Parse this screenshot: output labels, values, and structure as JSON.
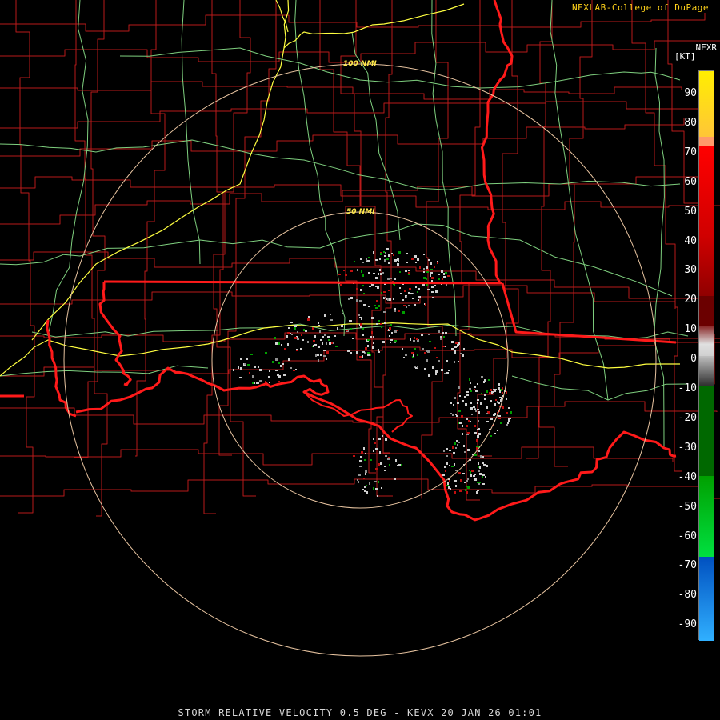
{
  "credit": "NEXLAB-College of DuPage",
  "product_code": "NEXR",
  "units": "[KT]",
  "caption": "STORM RELATIVE VELOCITY 0.5 DEG - KEVX 20 JAN 26 01:01",
  "range_rings": [
    {
      "label": "50 NMI",
      "nmi": 50
    },
    {
      "label": "100 NMI",
      "nmi": 100
    }
  ],
  "legend": {
    "ticks": [
      "90",
      "80",
      "70",
      "60",
      "50",
      "40",
      "30",
      "20",
      "10",
      "0",
      "-10",
      "-20",
      "-30",
      "-40",
      "-50",
      "-60",
      "-70",
      "-80",
      "-90"
    ],
    "colors": [
      {
        "from": 90,
        "to": 70,
        "color": "#ffd800"
      },
      {
        "from": 73,
        "to": 70,
        "color": "#ff9a6a"
      },
      {
        "from": 70,
        "to": 20,
        "color": "#ff0000"
      },
      {
        "from": 20,
        "to": 10,
        "color": "#6b0000"
      },
      {
        "from": 10,
        "to": 0,
        "color": "#b0b0b0"
      },
      {
        "from": 0,
        "to": -10,
        "color": "#505050"
      },
      {
        "from": -10,
        "to": -40,
        "color": "#006800"
      },
      {
        "from": -40,
        "to": -67,
        "color": "#00c800"
      },
      {
        "from": -67,
        "to": -90,
        "color": "#0070ff"
      }
    ]
  },
  "colors": {
    "county_lines": "#b81a1a",
    "state_lines": "#ff1a1a",
    "highways": "#7fd07f",
    "interstates": "#ffff40",
    "range_rings": "#e8c4a0",
    "receding_echo": "#d0d0d0",
    "approaching_echo": "#00a000"
  }
}
